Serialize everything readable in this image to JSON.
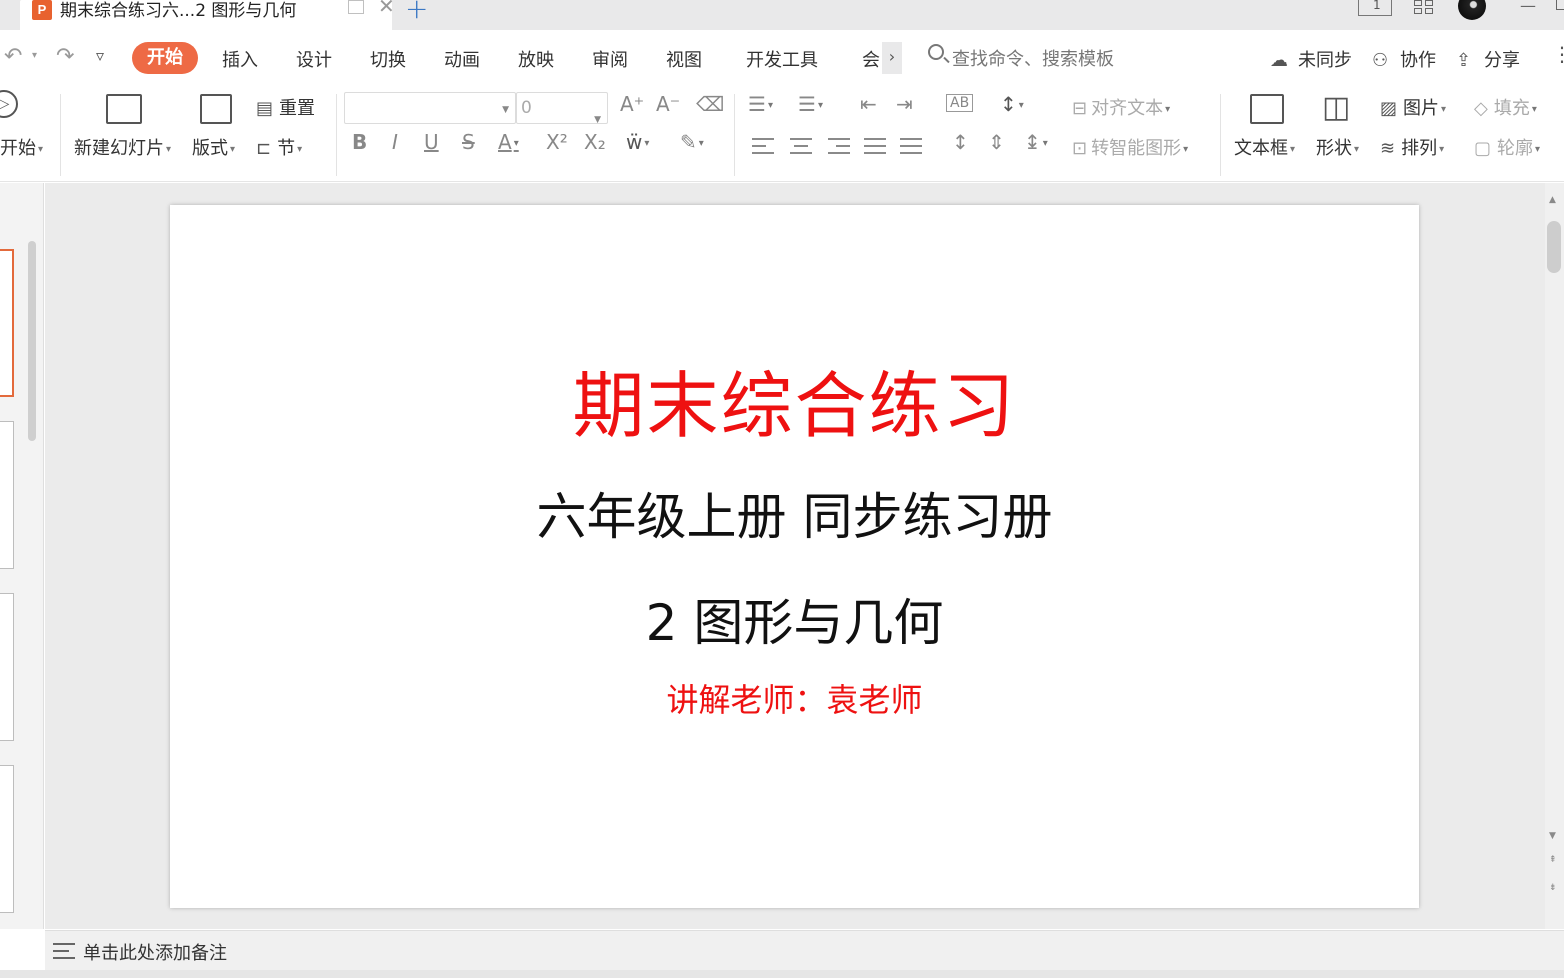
{
  "window": {
    "tab_icon_letter": "P",
    "doc_tab_title": "期末综合练习六...2 图形与几何",
    "new_tab_symbol": "+",
    "close_symbol": "✕",
    "layout_label": "1"
  },
  "menu": {
    "tabs": [
      "开始",
      "插入",
      "设计",
      "切换",
      "动画",
      "放映",
      "审阅",
      "视图",
      "开发工具",
      "会"
    ],
    "more_symbol": "›",
    "search_placeholder": "查找命令、搜索模板",
    "right_actions": {
      "sync": "未同步",
      "collab": "协作",
      "share": "分享"
    }
  },
  "ribbon": {
    "start_label": "开始",
    "new_slide": "新建幻灯片",
    "layout": "版式",
    "reset": "重置",
    "section": "节",
    "font_name": "",
    "font_size": "0",
    "align_text": "对齐文本",
    "smart_shape": "转智能图形",
    "textbox": "文本框",
    "shape": "形状",
    "picture": "图片",
    "fill": "填充",
    "arrange": "排列",
    "outline": "轮廓"
  },
  "slide": {
    "title": "期末综合练习",
    "subtitle": "六年级上册 同步练习册",
    "unit": "2 图形与几何",
    "teacher": "讲解老师：袁老师"
  },
  "notes": {
    "placeholder": "单击此处添加备注"
  },
  "colors": {
    "accent": "#ee6a45",
    "slide_title": "#ee1111",
    "slide_teacher": "#ee1111"
  }
}
